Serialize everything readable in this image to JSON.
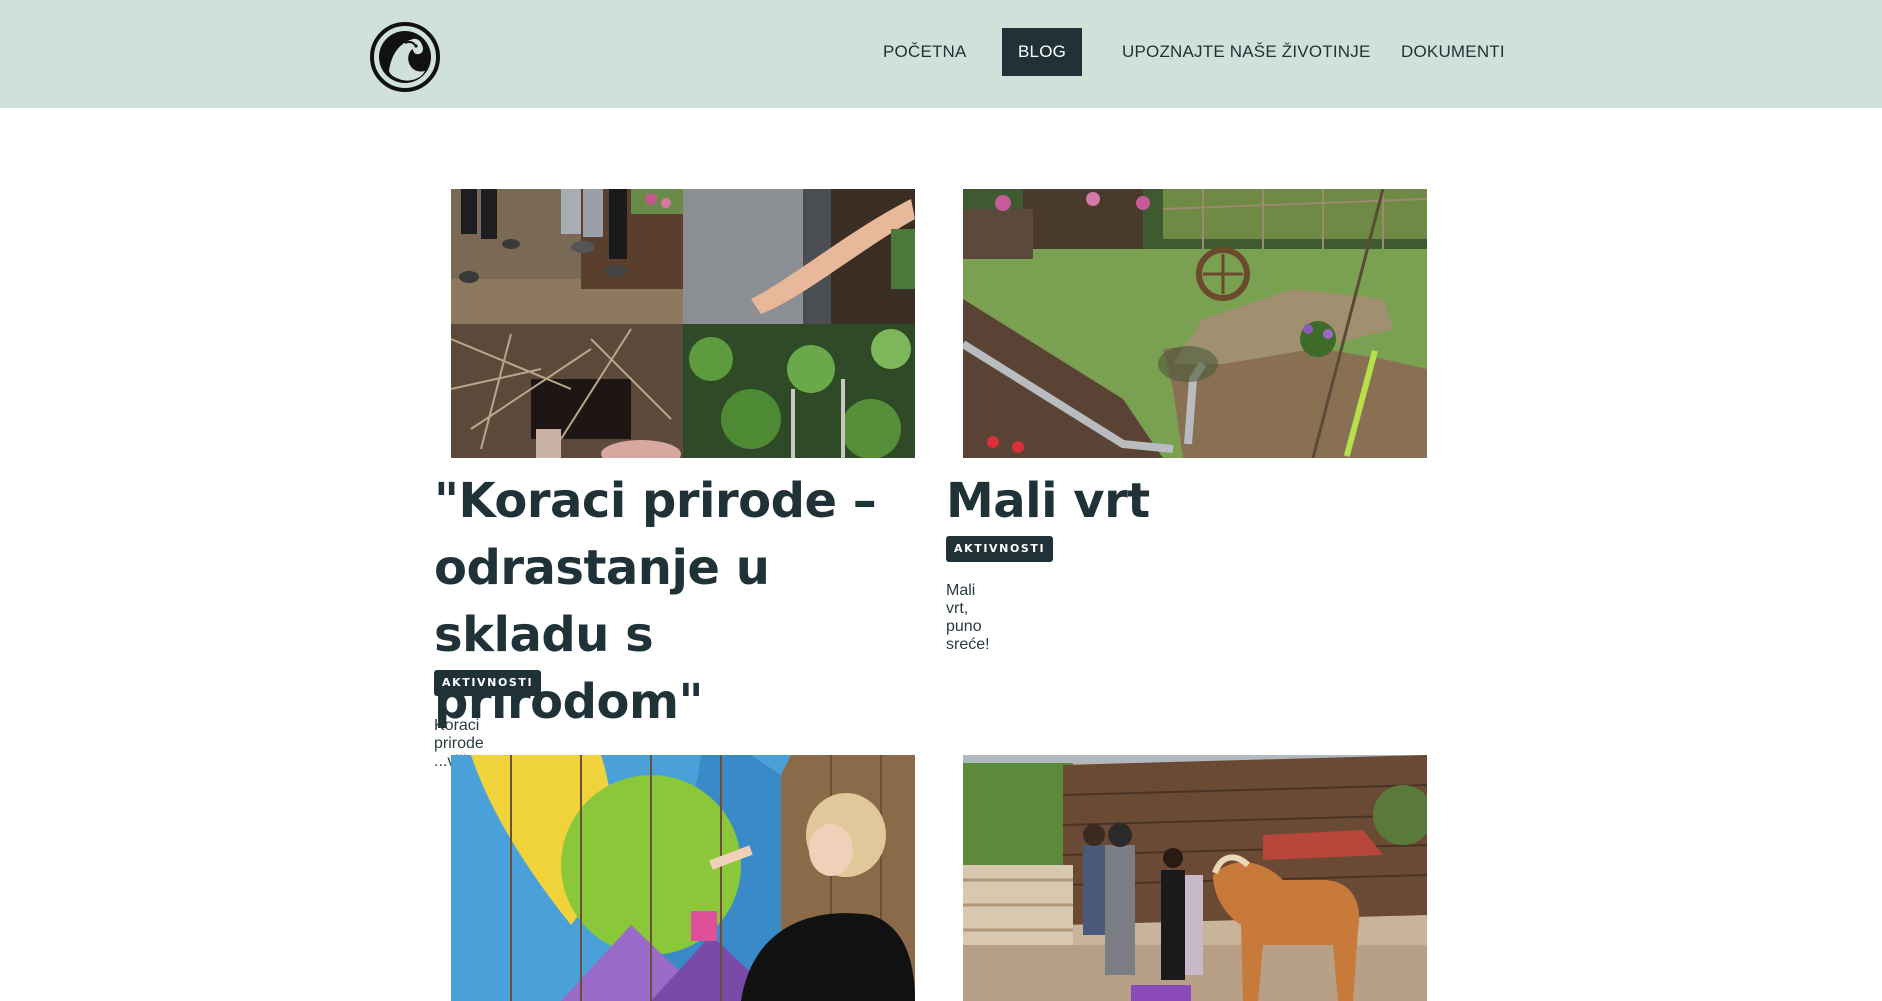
{
  "header": {
    "logo_name": "horse-logo",
    "nav": [
      {
        "label": "POČETNA",
        "active": false
      },
      {
        "label": "BLOG",
        "active": true
      },
      {
        "label": "UPOZNAJTE NAŠE ŽIVOTINJE",
        "active": false
      },
      {
        "label": "DOKUMENTI",
        "active": false
      }
    ]
  },
  "posts": [
    {
      "title": "\"Koraci prirode – odrastanje u skladu s prirodom\"",
      "tag": "AKTIVNOSTI",
      "excerpt": "Koraci prirode ...više...",
      "image": "collage of garden work photos"
    },
    {
      "title": "Mali vrt",
      "tag": "AKTIVNOSTI",
      "excerpt": "Mali vrt, puno sreće!",
      "image": "small garden with flower beds and wooden wheel"
    },
    {
      "title": "",
      "tag": "",
      "excerpt": "",
      "image": "girl painting colorful mural on wooden wall"
    },
    {
      "title": "",
      "tag": "",
      "excerpt": "",
      "image": "group of people with a horse at a farm"
    }
  ],
  "colors": {
    "header_bg": "#cfe1d8",
    "accent_dark": "#203238",
    "text": "#1f3238"
  }
}
